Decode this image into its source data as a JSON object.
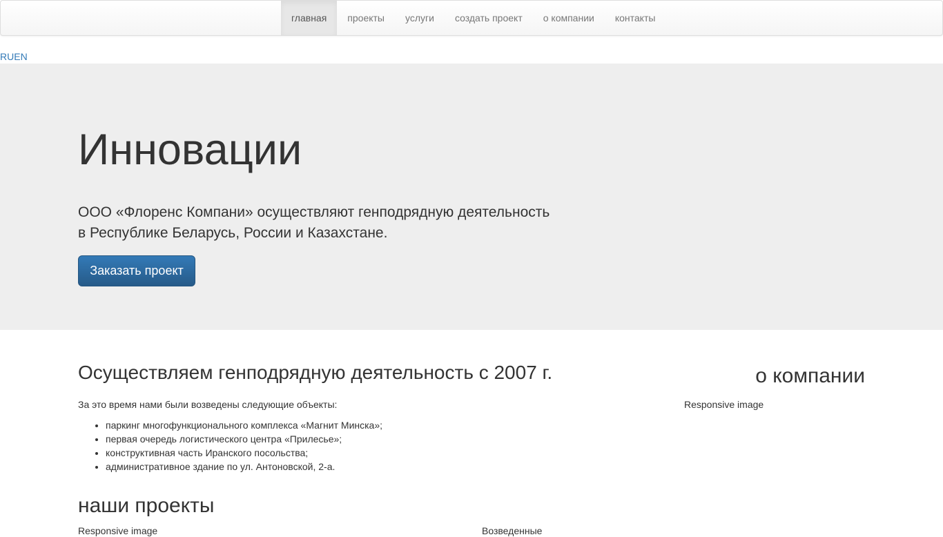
{
  "nav": {
    "items": [
      {
        "label": "главная",
        "active": true
      },
      {
        "label": "проекты",
        "active": false
      },
      {
        "label": "услуги",
        "active": false
      },
      {
        "label": "создать проект",
        "active": false
      },
      {
        "label": "о компании",
        "active": false
      },
      {
        "label": "контакты",
        "active": false
      }
    ]
  },
  "lang": {
    "ru": "RU",
    "en": "EN"
  },
  "hero": {
    "title": "Инновации",
    "text": "ООО «Флоренс Компани» осуществляют генподрядную деятельность в Республике Беларусь, России и Казахстане.",
    "button_label": "Заказать проект"
  },
  "activity": {
    "title": "Осуществляем генподрядную деятельность с 2007 г.",
    "intro": "За это время нами были возведены следующие объекты:",
    "objects": [
      "паркинг многофункционального комплекса «Магнит Минска»;",
      "первая очередь логистического центра «Прилесье»;",
      "конструктивная часть Иранского посольства;",
      "административное здание по ул. Антоновской, 2-а."
    ]
  },
  "about": {
    "title": "о компании",
    "image_alt": "Responsive image"
  },
  "projects": {
    "title": "наши проекты",
    "image_alt": "Responsive image",
    "caption": "Возведенные"
  },
  "colors": {
    "link": "#337ab7",
    "primary_button": "#337ab7",
    "jumbotron_bg": "#eeeeee"
  }
}
